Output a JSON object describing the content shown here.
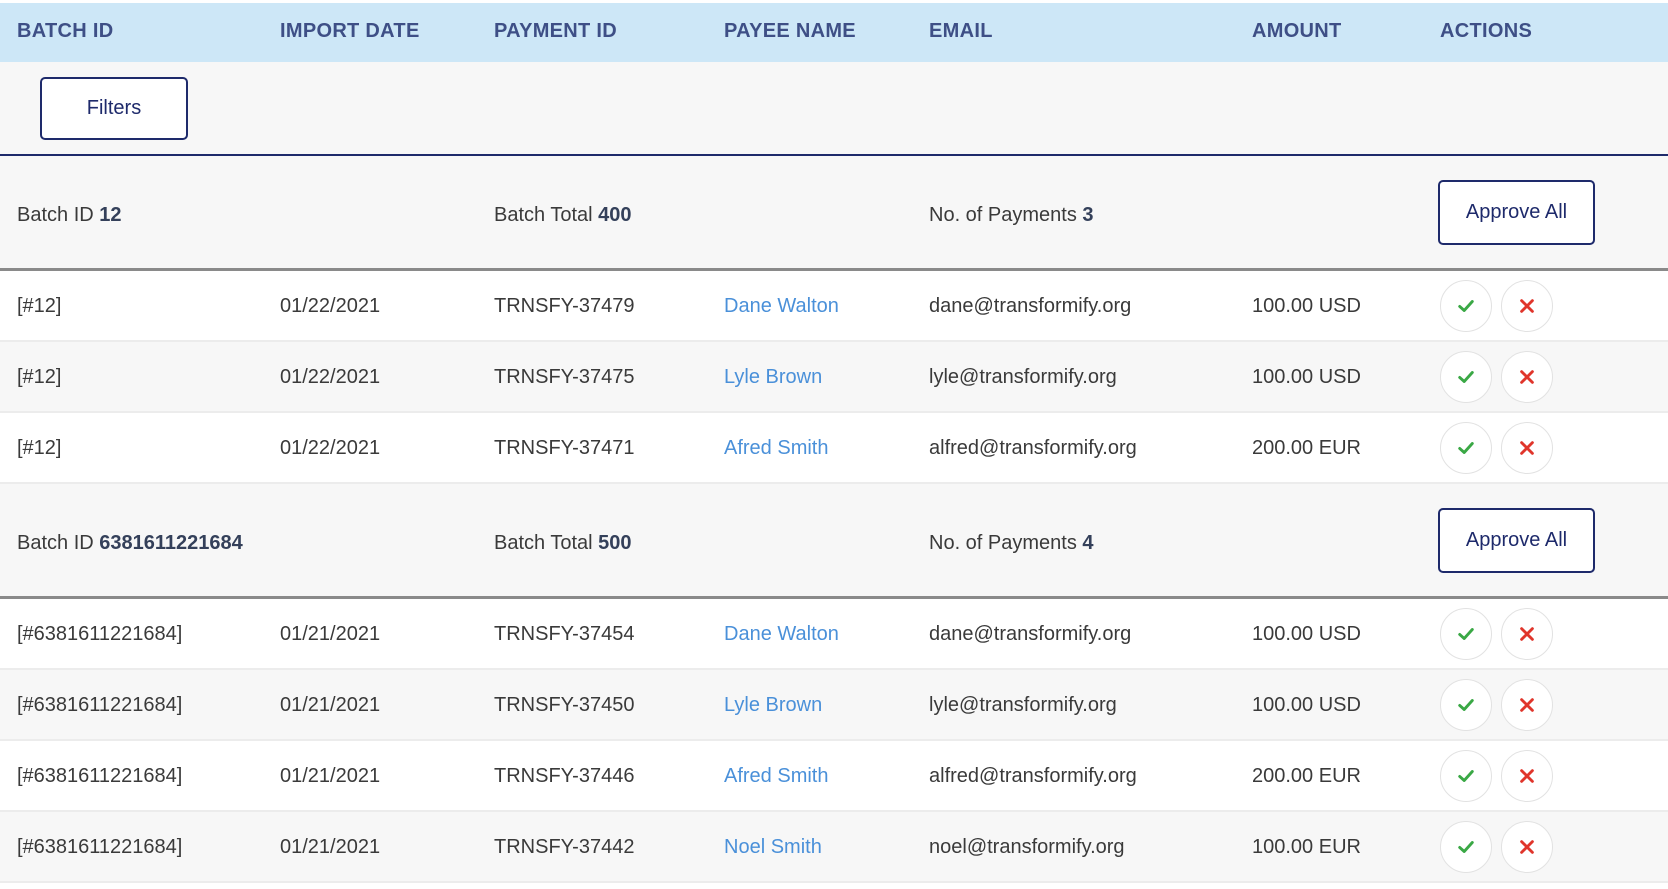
{
  "headers": {
    "batch_id": "BATCH ID",
    "import_date": "IMPORT DATE",
    "payment_id": "PAYMENT ID",
    "payee_name": "PAYEE NAME",
    "email": "EMAIL",
    "amount": "AMOUNT",
    "actions": "ACTIONS"
  },
  "filters_label": "Filters",
  "colors": {
    "accent": "#1e2a6b",
    "header_bg": "#cde7f7",
    "link": "#4a90d9",
    "approve": "#3aa845",
    "reject": "#e0352b"
  },
  "batches": [
    {
      "batch_id_label": "Batch ID",
      "batch_id": "12",
      "total_label": "Batch Total",
      "total": "400",
      "payments_label": "No. of Payments",
      "payments": "3",
      "approve_all": "Approve All",
      "rows": [
        {
          "batch": "[#12]",
          "date": "01/22/2021",
          "payment_id": "TRNSFY-37479",
          "payee": "Dane Walton",
          "email": "dane@transformify.org",
          "amount": "100.00 USD"
        },
        {
          "batch": "[#12]",
          "date": "01/22/2021",
          "payment_id": "TRNSFY-37475",
          "payee": "Lyle Brown",
          "email": "lyle@transformify.org",
          "amount": "100.00 USD"
        },
        {
          "batch": "[#12]",
          "date": "01/22/2021",
          "payment_id": "TRNSFY-37471",
          "payee": "Afred Smith",
          "email": "alfred@transformify.org",
          "amount": "200.00 EUR"
        }
      ]
    },
    {
      "batch_id_label": "Batch ID",
      "batch_id": "6381611221684",
      "total_label": "Batch Total",
      "total": "500",
      "payments_label": "No. of Payments",
      "payments": "4",
      "approve_all": "Approve All",
      "rows": [
        {
          "batch": "[#6381611221684]",
          "date": "01/21/2021",
          "payment_id": "TRNSFY-37454",
          "payee": "Dane Walton",
          "email": "dane@transformify.org",
          "amount": "100.00 USD"
        },
        {
          "batch": "[#6381611221684]",
          "date": "01/21/2021",
          "payment_id": "TRNSFY-37450",
          "payee": "Lyle Brown",
          "email": "lyle@transformify.org",
          "amount": "100.00 USD"
        },
        {
          "batch": "[#6381611221684]",
          "date": "01/21/2021",
          "payment_id": "TRNSFY-37446",
          "payee": "Afred Smith",
          "email": "alfred@transformify.org",
          "amount": "200.00 EUR"
        },
        {
          "batch": "[#6381611221684]",
          "date": "01/21/2021",
          "payment_id": "TRNSFY-37442",
          "payee": "Noel Smith",
          "email": "noel@transformify.org",
          "amount": "100.00 EUR"
        }
      ]
    }
  ],
  "icons": {
    "approve": "check-icon",
    "reject": "close-icon"
  }
}
